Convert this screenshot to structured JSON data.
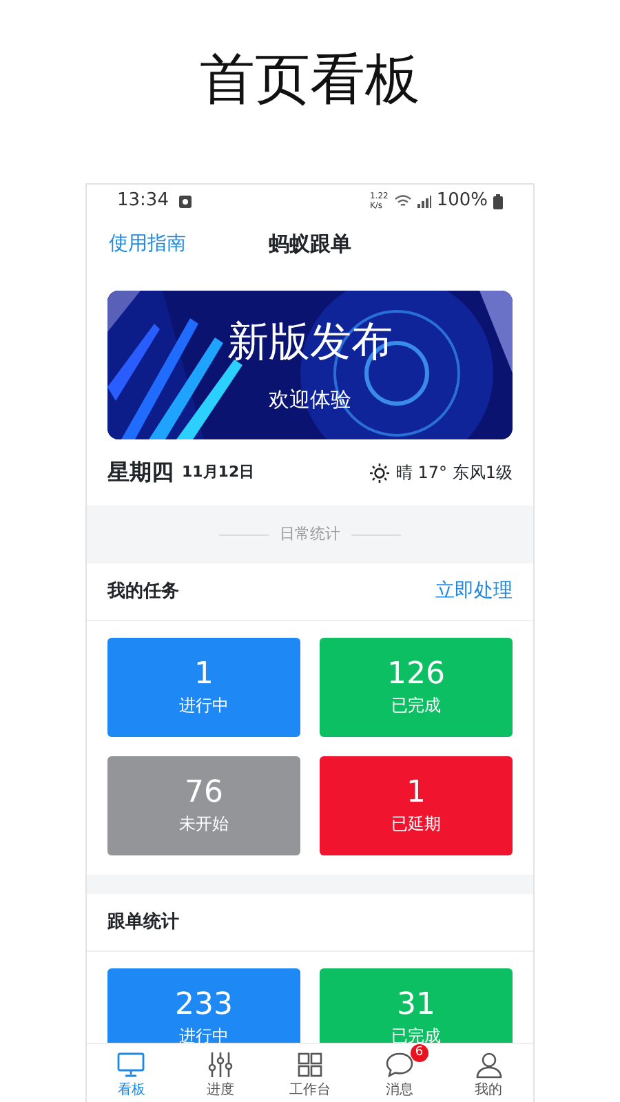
{
  "page_title": "首页看板",
  "status_bar": {
    "time": "13:34",
    "net_speed": "1.22",
    "net_unit": "K/s",
    "battery": "100%"
  },
  "nav": {
    "left_link": "使用指南",
    "title": "蚂蚁跟单"
  },
  "banner": {
    "kind": "picture",
    "title": "新版发布",
    "subtitle": "欢迎体验"
  },
  "date": {
    "weekday": "星期四",
    "date": "11月12日",
    "weather": "晴 17° 东风1级"
  },
  "divider_label": "日常统计",
  "sections": [
    {
      "title": "我的任务",
      "action": "立即处理",
      "tiles": [
        {
          "value": "1",
          "label": "进行中",
          "color": "#1e88f5"
        },
        {
          "value": "126",
          "label": "已完成",
          "color": "#0dbf63"
        },
        {
          "value": "76",
          "label": "未开始",
          "color": "#939598"
        },
        {
          "value": "1",
          "label": "已延期",
          "color": "#f0142e"
        }
      ]
    },
    {
      "title": "跟单统计",
      "tiles": [
        {
          "value": "233",
          "label": "进行中",
          "color": "#1e88f5"
        },
        {
          "value": "31",
          "label": "已完成",
          "color": "#0dbf63"
        }
      ]
    }
  ],
  "tab_bar": [
    {
      "kind": "monitor",
      "label": "看板",
      "selected": true
    },
    {
      "kind": "sliders",
      "label": "进度",
      "selected": false
    },
    {
      "kind": "grid",
      "label": "工作台",
      "selected": false
    },
    {
      "kind": "chat",
      "label": "消息",
      "selected": false,
      "badge": "6"
    },
    {
      "kind": "person",
      "label": "我的",
      "selected": false
    }
  ]
}
